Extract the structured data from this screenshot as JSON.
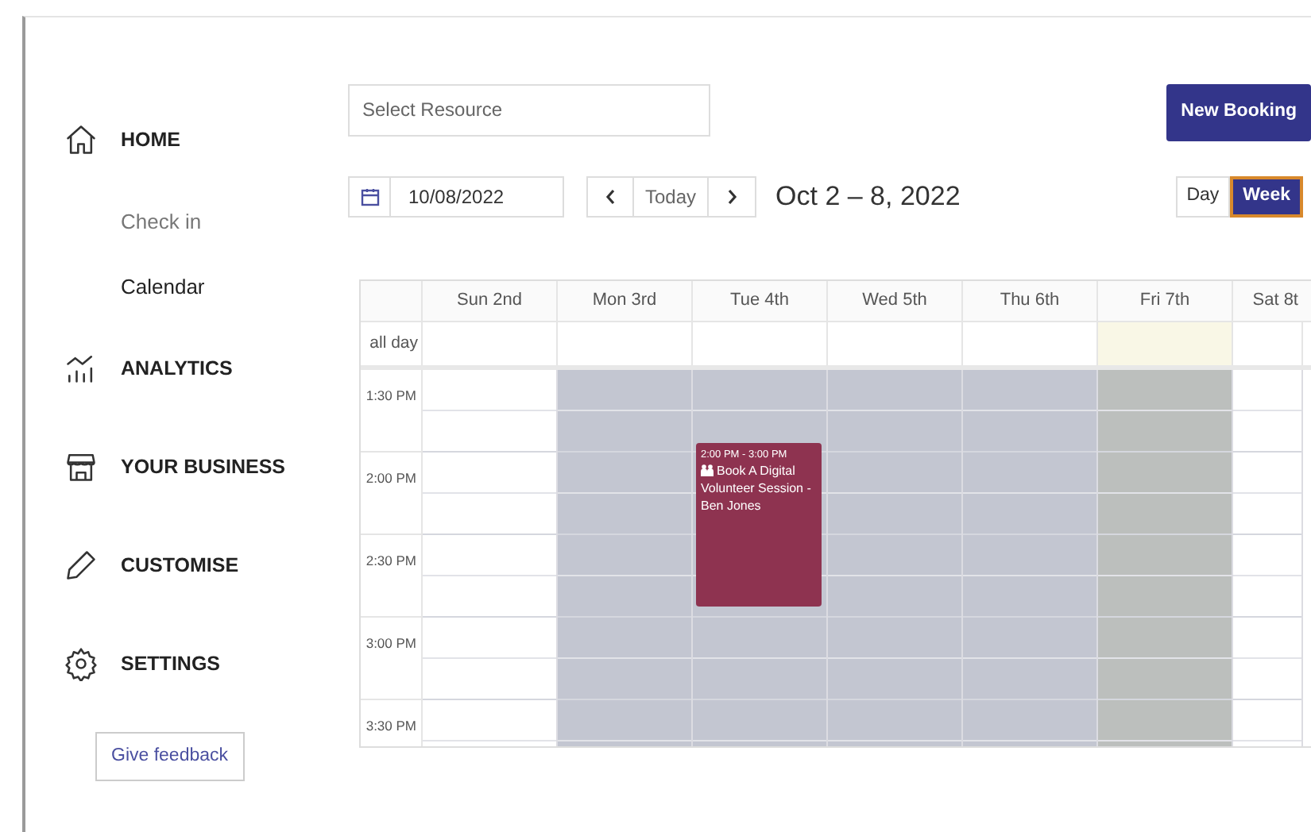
{
  "sidebar": {
    "items": [
      {
        "kind": "section",
        "label": "HOME"
      },
      {
        "kind": "sub",
        "label": "Check in",
        "selected": false
      },
      {
        "kind": "sub",
        "label": "Calendar",
        "selected": true
      },
      {
        "kind": "section",
        "label": "ANALYTICS"
      },
      {
        "kind": "section",
        "label": "YOUR BUSINESS"
      },
      {
        "kind": "section",
        "label": "CUSTOMISE"
      },
      {
        "kind": "section",
        "label": "SETTINGS"
      }
    ],
    "feedback_button": "Give feedback"
  },
  "toolbar": {
    "resource_select": {
      "placeholder": "Select Resource"
    },
    "new_booking": "New Booking",
    "date": "10/08/2022",
    "today": "Today",
    "range": "Oct 2 – 8, 2022",
    "views": [
      {
        "label": "Day",
        "selected": false
      },
      {
        "label": "Week",
        "selected": true
      }
    ]
  },
  "calendar": {
    "allday_label": "all day",
    "days": [
      {
        "label": "Sun 2nd",
        "closed": false,
        "highlighted": false
      },
      {
        "label": "Mon 3rd",
        "closed": true,
        "highlighted": false
      },
      {
        "label": "Tue 4th",
        "closed": true,
        "highlighted": false,
        "events": [
          {
            "time": "2:00 PM - 3:00 PM",
            "title": "Book A Digital Volunteer Session - Ben Jones",
            "color": "#8e3350"
          }
        ]
      },
      {
        "label": "Wed 5th",
        "closed": true,
        "highlighted": false
      },
      {
        "label": "Thu 6th",
        "closed": true,
        "highlighted": false
      },
      {
        "label": "Fri 7th",
        "closed": true,
        "highlighted": true
      },
      {
        "label": "Sat 8t",
        "closed": false,
        "highlighted": false
      }
    ],
    "times": [
      "1:30 PM",
      "2:00 PM",
      "2:30 PM",
      "3:00 PM",
      "3:30 PM"
    ]
  }
}
